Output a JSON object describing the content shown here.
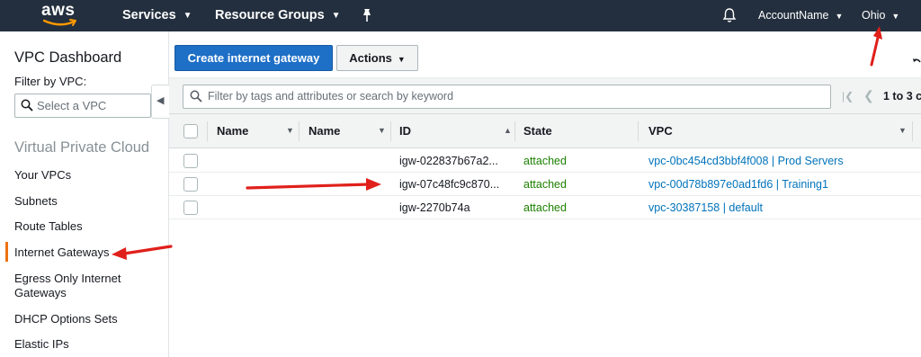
{
  "topnav": {
    "logo_text": "aws",
    "services_label": "Services",
    "resource_groups_label": "Resource Groups",
    "account_label": "AccountName",
    "region_label": "Ohio",
    "caret": "▼",
    "bell_icon": "bell-icon",
    "pin_icon": "pin-icon"
  },
  "sidebar": {
    "title": "VPC Dashboard",
    "filter_label": "Filter by VPC:",
    "select_placeholder": "Select a VPC",
    "section_title": "Virtual Private Cloud",
    "items": [
      {
        "label": "Your VPCs"
      },
      {
        "label": "Subnets"
      },
      {
        "label": "Route Tables"
      },
      {
        "label": "Internet Gateways",
        "active": true
      },
      {
        "label": "Egress Only Internet Gateways"
      },
      {
        "label": "DHCP Options Sets"
      },
      {
        "label": "Elastic IPs"
      }
    ],
    "active_color": "#ec7211",
    "collapse_icon": "◀"
  },
  "toolbar": {
    "create_label": "Create internet gateway",
    "actions_label": "Actions",
    "caret": "▼"
  },
  "filter": {
    "placeholder": "Filter by tags and attributes or search by keyword",
    "first_icon": "|❮",
    "prev_icon": "❮",
    "page_text": "1 to 3 c"
  },
  "table": {
    "headers": {
      "name1": "Name",
      "name2": "Name",
      "id": "ID",
      "state": "State",
      "vpc": "VPC"
    },
    "sort_up": "▲",
    "caret": "▼",
    "rows": [
      {
        "id": "igw-022837b67a2...",
        "state": "attached",
        "vpc": "vpc-0bc454cd3bbf4f008 | Prod Servers"
      },
      {
        "id": "igw-07c48fc9c870...",
        "state": "attached",
        "vpc": "vpc-00d78b897e0ad1fd6 | Training1"
      },
      {
        "id": "igw-2270b74a",
        "state": "attached",
        "vpc": "vpc-30387158 | default"
      }
    ]
  },
  "colors": {
    "nav_bg": "#232f3e",
    "primary": "#1e6fc6",
    "state_green": "#1d8102",
    "link_blue": "#0073bb",
    "annotation_red": "#e0201b"
  }
}
